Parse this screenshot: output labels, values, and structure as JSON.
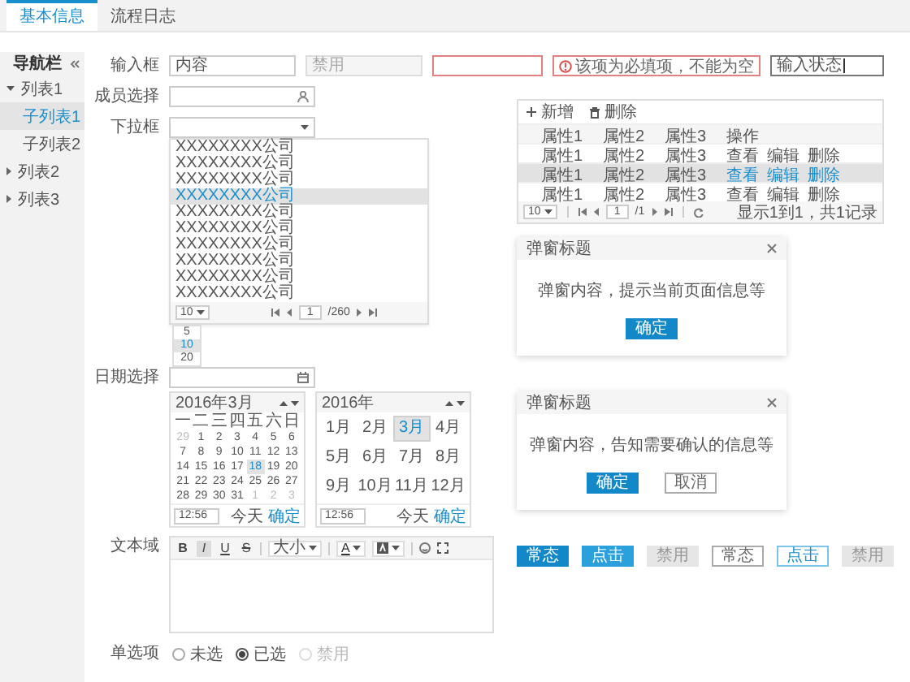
{
  "tabs": [
    {
      "label": "基本信息",
      "selected": true
    },
    {
      "label": "流程日志",
      "selected": false
    }
  ],
  "sidebar": {
    "title": "导航栏",
    "items": [
      {
        "label": "列表1",
        "expanded": true,
        "selected": false,
        "children": [
          {
            "label": "子列表1",
            "selected": true
          },
          {
            "label": "子列表2",
            "selected": false
          }
        ]
      },
      {
        "label": "列表2",
        "expanded": false,
        "selected": false
      },
      {
        "label": "列表3",
        "expanded": false,
        "selected": false
      }
    ]
  },
  "text_inputs": {
    "label": "输入框",
    "fields": [
      {
        "kind": "normal",
        "value": "内容"
      },
      {
        "kind": "disabled",
        "placeholder": "禁用"
      },
      {
        "kind": "error",
        "error": "该项为必填项，不能为空"
      },
      {
        "kind": "focused",
        "value": "输入状态"
      }
    ]
  },
  "member_select": {
    "label": "成员选择"
  },
  "dropdown": {
    "label": "下拉框",
    "options": [
      {
        "label": "XXXXXXXX公司",
        "selected": false
      },
      {
        "label": "XXXXXXXX公司",
        "selected": false
      },
      {
        "label": "XXXXXXXX公司",
        "selected": false
      },
      {
        "label": "XXXXXXXX公司",
        "selected": true
      },
      {
        "label": "XXXXXXXX公司",
        "selected": false
      },
      {
        "label": "XXXXXXXX公司",
        "selected": false
      },
      {
        "label": "XXXXXXXX公司",
        "selected": false
      },
      {
        "label": "XXXXXXXX公司",
        "selected": false
      },
      {
        "label": "XXXXXXXX公司",
        "selected": false
      },
      {
        "label": "XXXXXXXX公司",
        "selected": false
      }
    ],
    "pager": {
      "page_size": "10",
      "page": "1",
      "total": "/260"
    },
    "size_options": [
      {
        "label": "5",
        "selected": false
      },
      {
        "label": "10",
        "selected": true
      },
      {
        "label": "20",
        "selected": false
      }
    ]
  },
  "date_picker": {
    "label": "日期选择",
    "calendar": {
      "title": "2016年3月",
      "weekdays": [
        "一",
        "二",
        "三",
        "四",
        "五",
        "六",
        "日"
      ],
      "days": [
        {
          "label": "29",
          "muted": true,
          "selected": false
        },
        {
          "label": "1",
          "muted": false,
          "selected": false
        },
        {
          "label": "2",
          "muted": false,
          "selected": false
        },
        {
          "label": "3",
          "muted": false,
          "selected": false
        },
        {
          "label": "4",
          "muted": false,
          "selected": false
        },
        {
          "label": "5",
          "muted": false,
          "selected": false
        },
        {
          "label": "6",
          "muted": false,
          "selected": false
        },
        {
          "label": "7",
          "muted": false,
          "selected": false
        },
        {
          "label": "8",
          "muted": false,
          "selected": false
        },
        {
          "label": "9",
          "muted": false,
          "selected": false
        },
        {
          "label": "10",
          "muted": false,
          "selected": false
        },
        {
          "label": "11",
          "muted": false,
          "selected": false
        },
        {
          "label": "12",
          "muted": false,
          "selected": false
        },
        {
          "label": "13",
          "muted": false,
          "selected": false
        },
        {
          "label": "14",
          "muted": false,
          "selected": false
        },
        {
          "label": "15",
          "muted": false,
          "selected": false
        },
        {
          "label": "16",
          "muted": false,
          "selected": false
        },
        {
          "label": "17",
          "muted": false,
          "selected": false
        },
        {
          "label": "18",
          "muted": false,
          "selected": true
        },
        {
          "label": "19",
          "muted": false,
          "selected": false
        },
        {
          "label": "20",
          "muted": false,
          "selected": false
        },
        {
          "label": "21",
          "muted": false,
          "selected": false
        },
        {
          "label": "22",
          "muted": false,
          "selected": false
        },
        {
          "label": "23",
          "muted": false,
          "selected": false
        },
        {
          "label": "24",
          "muted": false,
          "selected": false
        },
        {
          "label": "25",
          "muted": false,
          "selected": false
        },
        {
          "label": "26",
          "muted": false,
          "selected": false
        },
        {
          "label": "27",
          "muted": false,
          "selected": false
        },
        {
          "label": "28",
          "muted": false,
          "selected": false
        },
        {
          "label": "29",
          "muted": false,
          "selected": false
        },
        {
          "label": "30",
          "muted": false,
          "selected": false
        },
        {
          "label": "31",
          "muted": false,
          "selected": false
        },
        {
          "label": "1",
          "muted": true,
          "selected": false
        },
        {
          "label": "2",
          "muted": true,
          "selected": false
        },
        {
          "label": "3",
          "muted": true,
          "selected": false
        }
      ],
      "time": "12:56",
      "today": "今天",
      "confirm": "确定"
    },
    "month_picker": {
      "title": "2016年",
      "months": [
        {
          "label": "1月",
          "selected": false
        },
        {
          "label": "2月",
          "selected": false
        },
        {
          "label": "3月",
          "selected": true
        },
        {
          "label": "4月",
          "selected": false
        },
        {
          "label": "5月",
          "selected": false
        },
        {
          "label": "6月",
          "selected": false
        },
        {
          "label": "7月",
          "selected": false
        },
        {
          "label": "8月",
          "selected": false
        },
        {
          "label": "9月",
          "selected": false
        },
        {
          "label": "10月",
          "selected": false
        },
        {
          "label": "11月",
          "selected": false
        },
        {
          "label": "12月",
          "selected": false
        }
      ],
      "time": "12:56",
      "today": "今天",
      "confirm": "确定"
    }
  },
  "editor": {
    "label": "文本域",
    "toolbar": [
      {
        "kind": "bold",
        "glyph": "B",
        "pressed": false
      },
      {
        "kind": "italic",
        "glyph": "I",
        "pressed": true
      },
      {
        "kind": "underline",
        "glyph": "U",
        "pressed": false
      },
      {
        "kind": "strike",
        "glyph": "S",
        "pressed": false
      },
      {
        "kind": "separator"
      },
      {
        "kind": "size",
        "label": "大小"
      },
      {
        "kind": "separator"
      },
      {
        "kind": "color",
        "glyph": "A"
      },
      {
        "kind": "highlight"
      },
      {
        "kind": "separator"
      },
      {
        "kind": "emoji"
      },
      {
        "kind": "fullscreen"
      }
    ]
  },
  "radio": {
    "label": "单选项",
    "options": [
      {
        "label": "未选",
        "selected": false,
        "disabled": false
      },
      {
        "label": "已选",
        "selected": true,
        "disabled": false
      },
      {
        "label": "禁用",
        "selected": false,
        "disabled": true
      }
    ]
  },
  "table": {
    "toolbar": [
      {
        "kind": "add",
        "label": "新增"
      },
      {
        "kind": "delete",
        "label": "删除"
      }
    ],
    "columns": [
      "属性1",
      "属性2",
      "属性3",
      "操作"
    ],
    "rows": [
      {
        "cells": [
          "属性1",
          "属性2",
          "属性3"
        ],
        "actions": [
          "查看",
          "编辑",
          "删除"
        ],
        "selected": false
      },
      {
        "cells": [
          "属性1",
          "属性2",
          "属性3"
        ],
        "actions": [
          "查看",
          "编辑",
          "删除"
        ],
        "selected": true
      },
      {
        "cells": [
          "属性1",
          "属性2",
          "属性3"
        ],
        "actions": [
          "查看",
          "编辑",
          "删除"
        ],
        "selected": false
      }
    ],
    "pager": {
      "page_size": "10",
      "page": "1",
      "total": "/1",
      "summary": "显示1到1，共1记录"
    }
  },
  "dialogs": [
    {
      "title": "弹窗标题",
      "message": "弹窗内容，提示当前页面信息等",
      "buttons": [
        {
          "kind": "primary",
          "label": "确定"
        }
      ]
    },
    {
      "title": "弹窗标题",
      "message": "弹窗内容，告知需要确认的信息等",
      "buttons": [
        {
          "kind": "primary",
          "label": "确定"
        },
        {
          "kind": "default",
          "label": "取消"
        }
      ]
    }
  ],
  "buttons": [
    {
      "kind": "solid",
      "active": false,
      "disabled": false,
      "label": "常态"
    },
    {
      "kind": "solid",
      "active": true,
      "disabled": false,
      "label": "点击"
    },
    {
      "kind": "solid",
      "active": false,
      "disabled": true,
      "label": "禁用"
    },
    {
      "kind": "outline",
      "active": false,
      "disabled": false,
      "label": "常态"
    },
    {
      "kind": "outline",
      "active": true,
      "disabled": false,
      "label": "点击"
    },
    {
      "kind": "outline",
      "active": false,
      "disabled": true,
      "label": "禁用"
    }
  ]
}
